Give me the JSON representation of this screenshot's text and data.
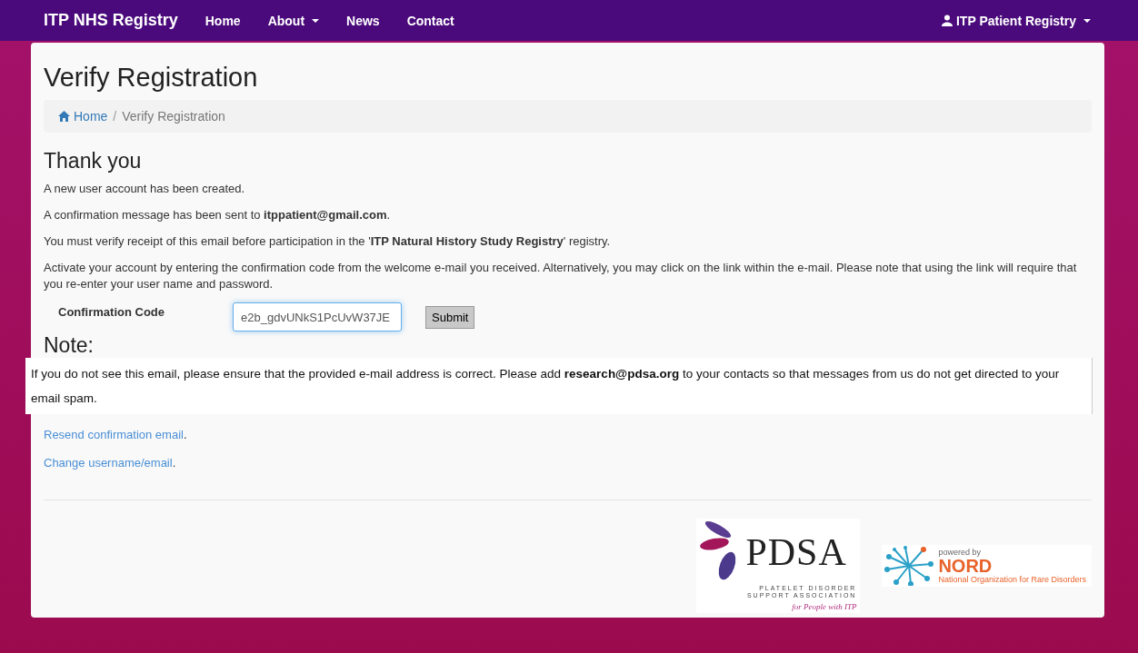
{
  "navbar": {
    "brand": "ITP NHS Registry",
    "items": [
      {
        "label": "Home",
        "dropdown": false
      },
      {
        "label": "About",
        "dropdown": true
      },
      {
        "label": "News",
        "dropdown": false
      },
      {
        "label": "Contact",
        "dropdown": false
      }
    ],
    "user_menu": "ITP Patient Registry"
  },
  "page_title": "Verify Registration",
  "breadcrumb": [
    {
      "label": "Home",
      "link": true
    },
    {
      "label": "Verify Registration",
      "link": false
    }
  ],
  "breadcrumb_separator": "/",
  "heading": "Thank you",
  "paragraphs": [
    "A new user account has been created.",
    "A confirmation message has been sent to **itppatient@gmail.com**.",
    "You must verify receipt of this email before participation in the '**ITP Natural History Study Registry**' registry.",
    "Activate your account by entering the confirmation code from the welcome e-mail you received. Alternatively, you may click on the link within the e-mail. Please note that using the link will require that you re-enter your user name and password."
  ],
  "form": {
    "label": "Confirmation Code",
    "value": "e2b_gdvUNkS1PcUvW37JE",
    "button": "Submit"
  },
  "note": {
    "heading": "Note:",
    "text": "If you do not see this email, please ensure that the provided e-mail address is correct. Please add **research@pdsa.org** to your contacts so that messages from us do not get directed to your email spam."
  },
  "links": [
    {
      "label": "Resend confirmation email",
      "suffix": "."
    },
    {
      "label": "Change username/email",
      "suffix": "."
    }
  ],
  "footer": {
    "pdsa": {
      "name": "PDSA",
      "line1": "PLATELET DISORDER",
      "line2": "SUPPORT ASSOCIATION",
      "tagline": "for People with ITP"
    },
    "nord": {
      "powered": "powered by",
      "name": "NORD",
      "full": "National Organization for Rare Disorders"
    }
  }
}
